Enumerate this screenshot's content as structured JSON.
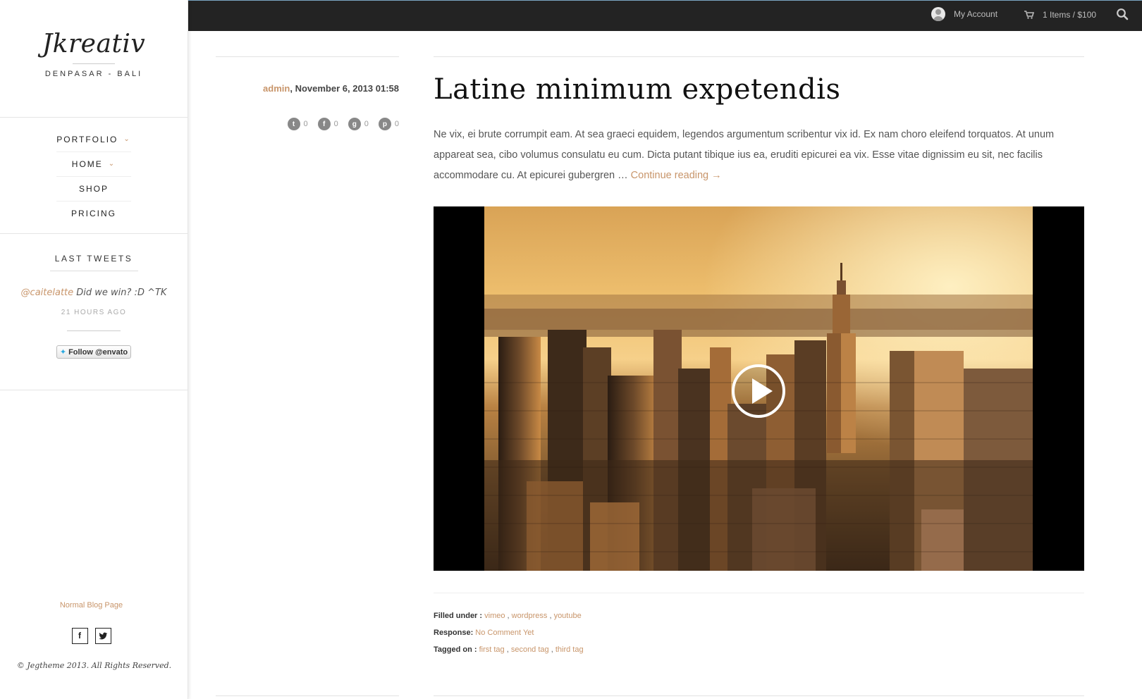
{
  "sidebar": {
    "brand": {
      "name": "Jkreativ",
      "tagline": "DENPASAR - BALI"
    },
    "menu": [
      {
        "label": "PORTFOLIO",
        "has_dropdown": true
      },
      {
        "label": "HOME",
        "has_dropdown": true
      },
      {
        "label": "SHOP",
        "has_dropdown": false
      },
      {
        "label": "PRICING",
        "has_dropdown": false
      }
    ],
    "tweets": {
      "title": "LAST TWEETS",
      "user": "@caitelatte",
      "text": " Did we win? :D ^TK",
      "time": "21 HOURS AGO",
      "follow_label": "Follow @envato"
    },
    "footer": {
      "blog_link": "Normal Blog Page",
      "social": [
        {
          "icon": "facebook-icon",
          "glyph": "f"
        },
        {
          "icon": "twitter-icon",
          "glyph": "t"
        }
      ],
      "copyright": "© Jegtheme 2013. All Rights Reserved."
    }
  },
  "topbar": {
    "account_label": "My Account",
    "cart_label": "1 Items / $100",
    "icons": [
      "avatar-icon",
      "cart-icon",
      "search-icon"
    ]
  },
  "post": {
    "author": "admin",
    "date": ", November 6, 2013 01:58",
    "shares": [
      {
        "icon": "twitter-icon",
        "glyph": "t",
        "count": "0"
      },
      {
        "icon": "facebook-icon",
        "glyph": "f",
        "count": "0"
      },
      {
        "icon": "google-plus-icon",
        "glyph": "g",
        "count": "0"
      },
      {
        "icon": "pinterest-icon",
        "glyph": "p",
        "count": "0"
      }
    ],
    "title": "Latine minimum expetendis",
    "excerpt": "Ne vix, ei brute corrumpit eam. At sea graeci equidem, legendos argumentum scribentur vix id. Ex nam choro eleifend torquatos. At unum appareat sea, cibo volumus consulatu eu cum. Dicta putant tibique ius ea, eruditi epicurei ea vix. Esse vitae dignissim eu sit, nec facilis accommodare cu. At epicurei gubergren … ",
    "continue_label": "Continue reading →",
    "video": {
      "icon": "play-icon"
    },
    "filed_label": "Filled under : ",
    "filed_links": [
      "vimeo",
      "wordpress",
      "youtube"
    ],
    "response_label": "Response: ",
    "response_value": "No Comment Yet",
    "tagged_label": "Tagged on : ",
    "tagged_links": [
      "first tag",
      "second tag",
      "third tag"
    ]
  },
  "colors": {
    "accent": "#c8956a",
    "topbar": "#232323",
    "text": "#555555"
  }
}
